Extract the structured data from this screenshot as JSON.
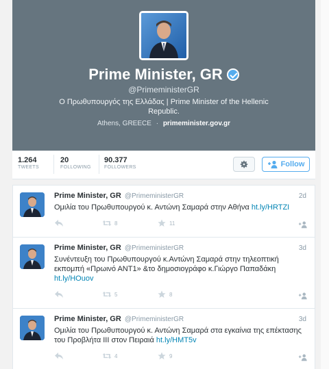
{
  "profile": {
    "name": "Prime Minister, GR",
    "handle": "@PrimeministerGR",
    "bio": "Ο Πρωθυπουργός της Ελλάδας | Prime Minister of the Hellenic Republic.",
    "location": "Athens, GREECE",
    "website": "primeminister.gov.gr",
    "separator": "·"
  },
  "stats": [
    {
      "value": "1.264",
      "label": "TWEETS"
    },
    {
      "value": "20",
      "label": "FOLLOWING"
    },
    {
      "value": "90.377",
      "label": "FOLLOWERS"
    }
  ],
  "actions": {
    "settings_icon": "gear-icon",
    "follow_label": "Follow"
  },
  "tweets": [
    {
      "name": "Prime Minister, GR",
      "handle": "@PrimeministerGR",
      "time": "2d",
      "text": "Ομιλία του Πρωθυπουργού κ. Αντώνη Σαμαρά στην Αθήνα ",
      "link": "ht.ly/HRTZI",
      "retweets": "8",
      "favorites": "11"
    },
    {
      "name": "Prime Minister, GR",
      "handle": "@PrimeministerGR",
      "time": "3d",
      "text": "Συνέντευξη του Πρωθυπουργού κ.Αντώνη Σαμαρά στην τηλεοπτική εκπομπή «Πρωινό ΑΝΤ1» &το δημοσιογράφο κ.Γιώργο Παπαδάκη ",
      "link": "ht.ly/HOuov",
      "retweets": "5",
      "favorites": "8"
    },
    {
      "name": "Prime Minister, GR",
      "handle": "@PrimeministerGR",
      "time": "3d",
      "text": "Ομιλία του Πρωθυπουργού κ. Αντώνη Σαμαρά στα εγκαίνια της επέκτασης του Προβλήτα ΙΙΙ στον Πειραιά ",
      "link": "ht.ly/HMT5v",
      "retweets": "4",
      "favorites": "9"
    }
  ]
}
